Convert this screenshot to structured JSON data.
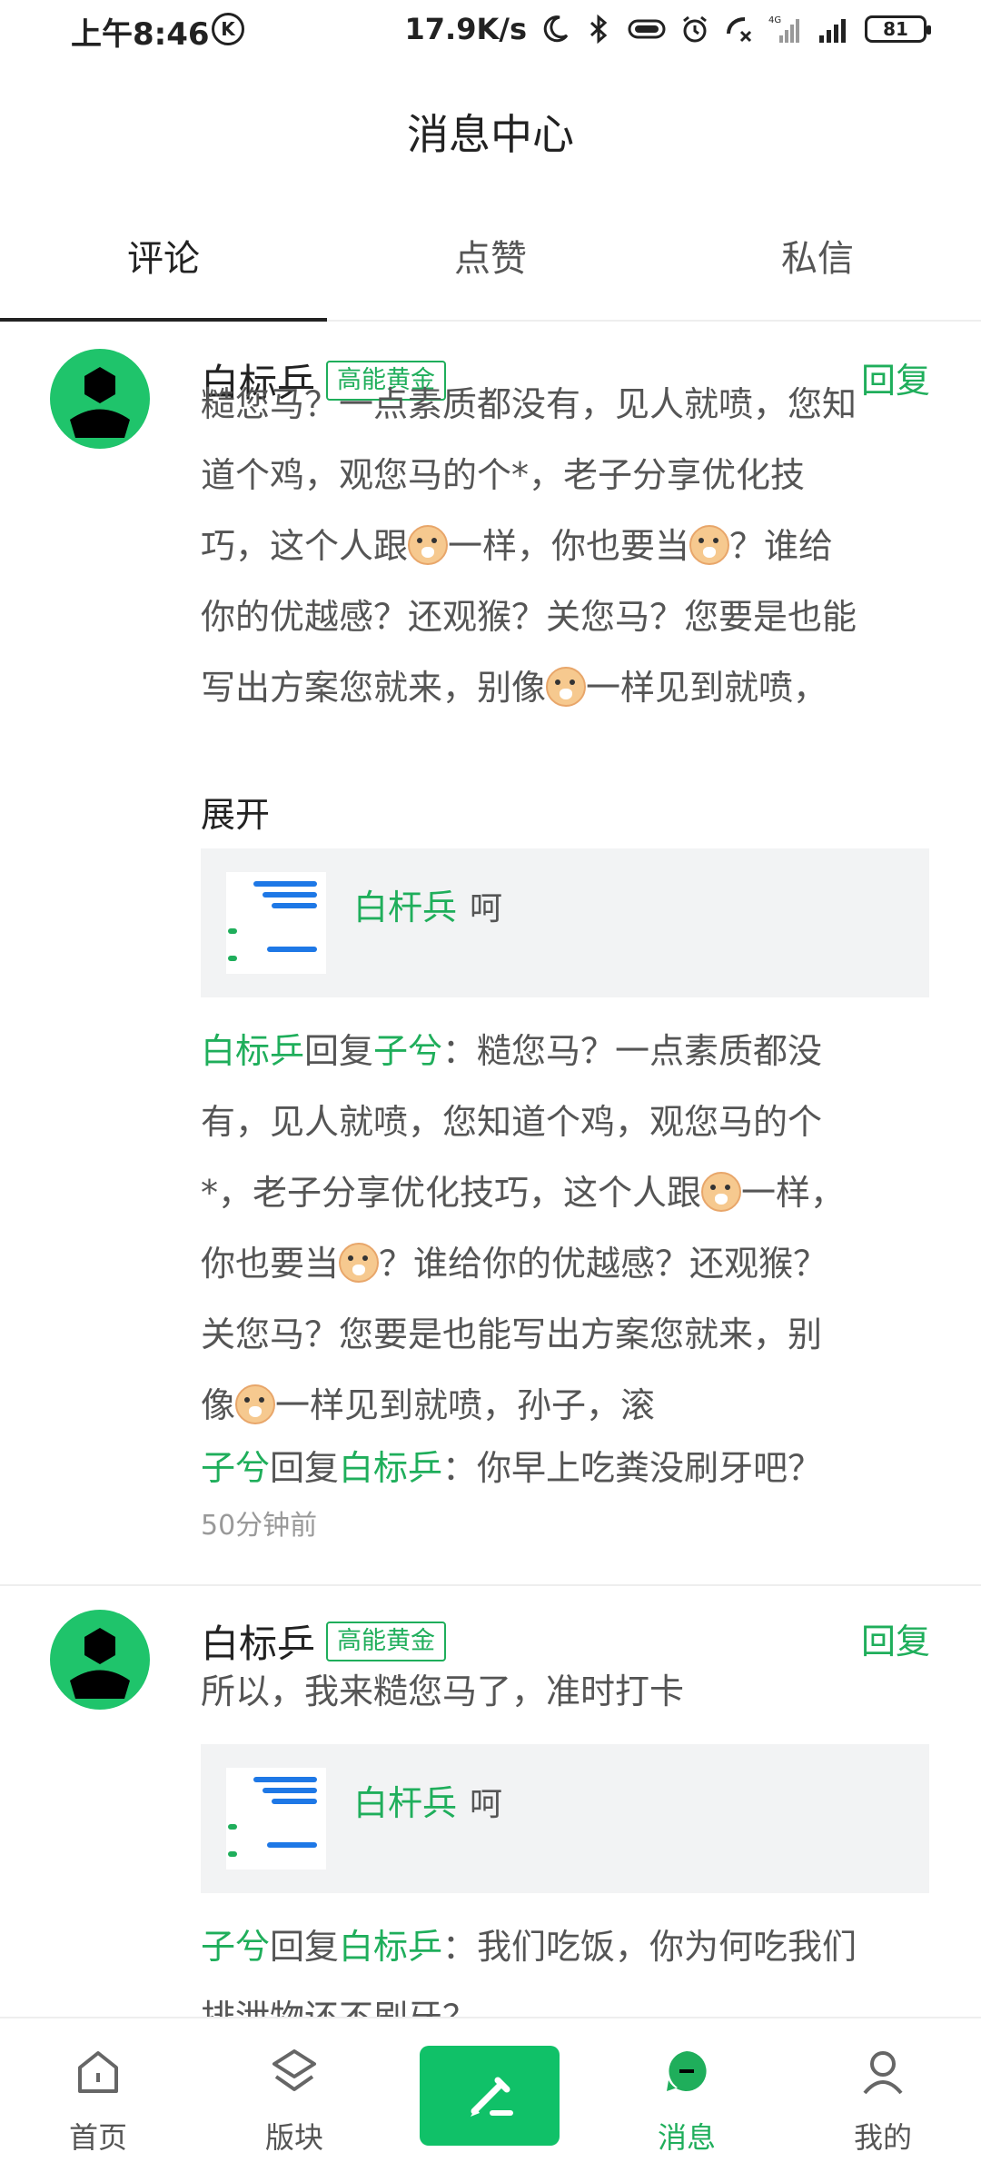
{
  "status_bar": {
    "time": "上午8:46",
    "k_label": "K",
    "net_speed": "17.9K/s",
    "battery": "81",
    "signal_label": "4G",
    "icons": [
      "moon-icon",
      "bluetooth-icon",
      "vibrate-icon",
      "alarm-icon",
      "call-icon",
      "signal-icon",
      "signal-icon",
      "battery-icon"
    ]
  },
  "header": {
    "title": "消息中心"
  },
  "tabs": [
    {
      "label": "评论",
      "active": true
    },
    {
      "label": "点赞",
      "active": false
    },
    {
      "label": "私信",
      "active": false
    }
  ],
  "comments": [
    {
      "username": "白标乒",
      "level": "高能黄金",
      "reply_label": "回复",
      "content_lines": [
        "糙您马？一点素质都没有，见人就喷，您知",
        "道个鸡，观您马的个*，老子分享优化技",
        [
          "巧，这个人跟",
          "emoji",
          "一样，你也要当",
          "emoji",
          "？谁给"
        ],
        "你的优越感？还观猴？关您马？您要是也能",
        [
          "写出方案您就来，别像",
          "emoji",
          "一样见到就喷，"
        ]
      ],
      "expand_label": "展开",
      "quote": {
        "author": "白杆兵",
        "text": "呵"
      },
      "replies": [
        {
          "from": "白标乒",
          "verb": "回复",
          "to": "子兮",
          "lines": [
            "：糙您马？一点素质都没",
            "有，见人就喷，您知道个鸡，观您马的个",
            [
              "*，老子分享优化技巧，这个人跟",
              "emoji",
              "一样，"
            ],
            [
              "你也要当",
              "emoji",
              "？谁给你的优越感？还观猴？"
            ],
            "关您马？您要是也能写出方案您就来，别",
            [
              "像",
              "emoji",
              "一样见到就喷，孙子，滚"
            ]
          ]
        },
        {
          "from": "子兮",
          "verb": "回复",
          "to": "白标乒",
          "lines": [
            "：你早上吃粪没刷牙吧？"
          ]
        }
      ],
      "time": "50分钟前"
    },
    {
      "username": "白标乒",
      "level": "高能黄金",
      "reply_label": "回复",
      "content_lines": [
        "所以，我来糙您马了，准时打卡"
      ],
      "quote": {
        "author": "白杆兵",
        "text": "呵"
      },
      "replies": [
        {
          "from": "子兮",
          "verb": "回复",
          "to": "白标乒",
          "lines": [
            "：我们吃饭，你为何吃我们",
            "排泄物还不刷牙？"
          ]
        }
      ]
    }
  ],
  "bottom_nav": [
    {
      "label": "首页",
      "icon": "home-icon",
      "active": false
    },
    {
      "label": "版块",
      "icon": "layers-icon",
      "active": false
    },
    {
      "label": "",
      "icon": "pen-icon",
      "active": false
    },
    {
      "label": "消息",
      "icon": "message-icon",
      "active": true
    },
    {
      "label": "我的",
      "icon": "profile-icon",
      "active": false
    }
  ],
  "colors": {
    "accent": "#1fae5b",
    "avatar_bg": "#1fc46b",
    "post_button": "#10c168"
  }
}
